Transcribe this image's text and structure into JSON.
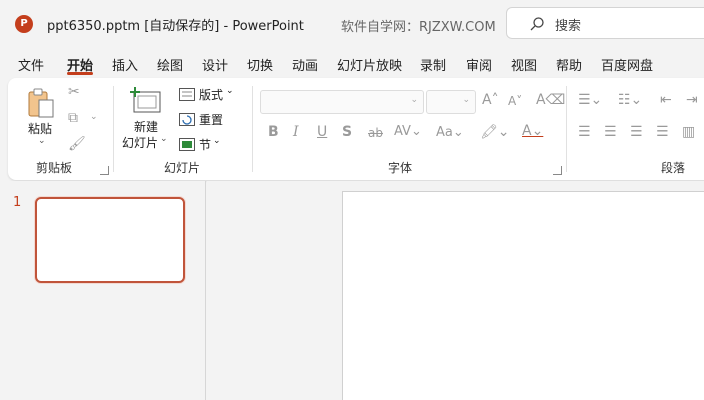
{
  "titlebar": {
    "logo_letter": "P",
    "doc_title": "ppt6350.pptm [自动保存的]  -  PowerPoint",
    "site_text": "软件自学网：RJZXW.COM",
    "search_placeholder": "搜索"
  },
  "tabs": [
    "文件",
    "开始",
    "插入",
    "绘图",
    "设计",
    "切换",
    "动画",
    "幻灯片放映",
    "录制",
    "审阅",
    "视图",
    "帮助",
    "百度网盘"
  ],
  "ribbon": {
    "clipboard": {
      "paste_label": "粘贴",
      "group_label": "剪贴板"
    },
    "slides": {
      "new_slide_line1": "新建",
      "new_slide_line2": "幻灯片",
      "layout_label": "版式",
      "reset_label": "重置",
      "section_label": "节",
      "group_label": "幻灯片"
    },
    "font": {
      "group_label": "字体"
    },
    "paragraph": {
      "group_label": "段落"
    }
  },
  "thumbnails": {
    "slide_number": "1"
  },
  "colors": {
    "accent": "#c43e1c"
  }
}
